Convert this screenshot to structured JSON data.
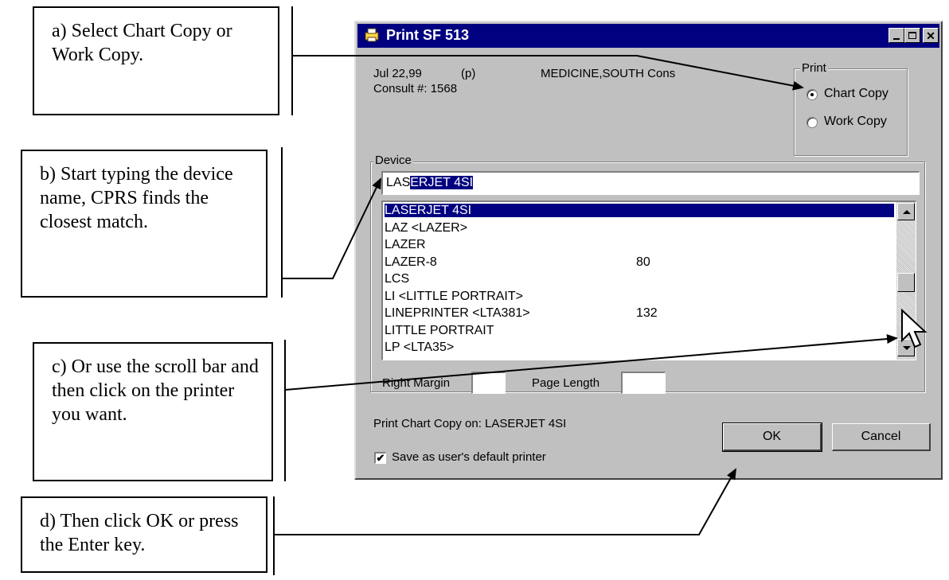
{
  "notes": {
    "a": "a) Select Chart Copy or Work Copy.",
    "b": "b) Start typing the device name, CPRS finds the closest match.",
    "c": "c) Or use the scroll bar and then click on the printer you want.",
    "d": "d) Then click OK or press the Enter key."
  },
  "dialog": {
    "title": "Print SF 513",
    "date": "Jul 22,99",
    "flag": "(p)",
    "service": "MEDICINE,SOUTH Cons",
    "consult": "Consult #: 1568",
    "print_group_label": "Print",
    "radio_chart": "Chart Copy",
    "radio_work": "Work Copy",
    "radio_selected": "Chart Copy",
    "device_group_label": "Device",
    "device_typed": "LAS",
    "device_autocomplete": "ERJET 4SI",
    "devices": [
      {
        "name": "LASERJET 4SI",
        "margin": ""
      },
      {
        "name": "LAZ  <LAZER>",
        "margin": ""
      },
      {
        "name": "LAZER",
        "margin": ""
      },
      {
        "name": "LAZER-8",
        "margin": "80"
      },
      {
        "name": "LCS",
        "margin": ""
      },
      {
        "name": "LI  <LITTLE PORTRAIT>",
        "margin": ""
      },
      {
        "name": "LINEPRINTER  <LTA381>",
        "margin": "132"
      },
      {
        "name": "LITTLE PORTRAIT",
        "margin": ""
      },
      {
        "name": "LP  <LTA35>",
        "margin": ""
      }
    ],
    "selected_device": "LASERJET 4SI",
    "right_margin_label": "Right Margin",
    "right_margin_value": "",
    "page_length_label": "Page Length",
    "page_length_value": "",
    "print_on_text": "Print Chart Copy on:  LASERJET 4SI",
    "ok_label": "OK",
    "cancel_label": "Cancel",
    "save_default_label": "Save as user's default printer",
    "save_default_checked": true
  },
  "colors": {
    "titlebar": "#000080",
    "dialog_face": "#c0c0c0",
    "selection": "#000080"
  }
}
